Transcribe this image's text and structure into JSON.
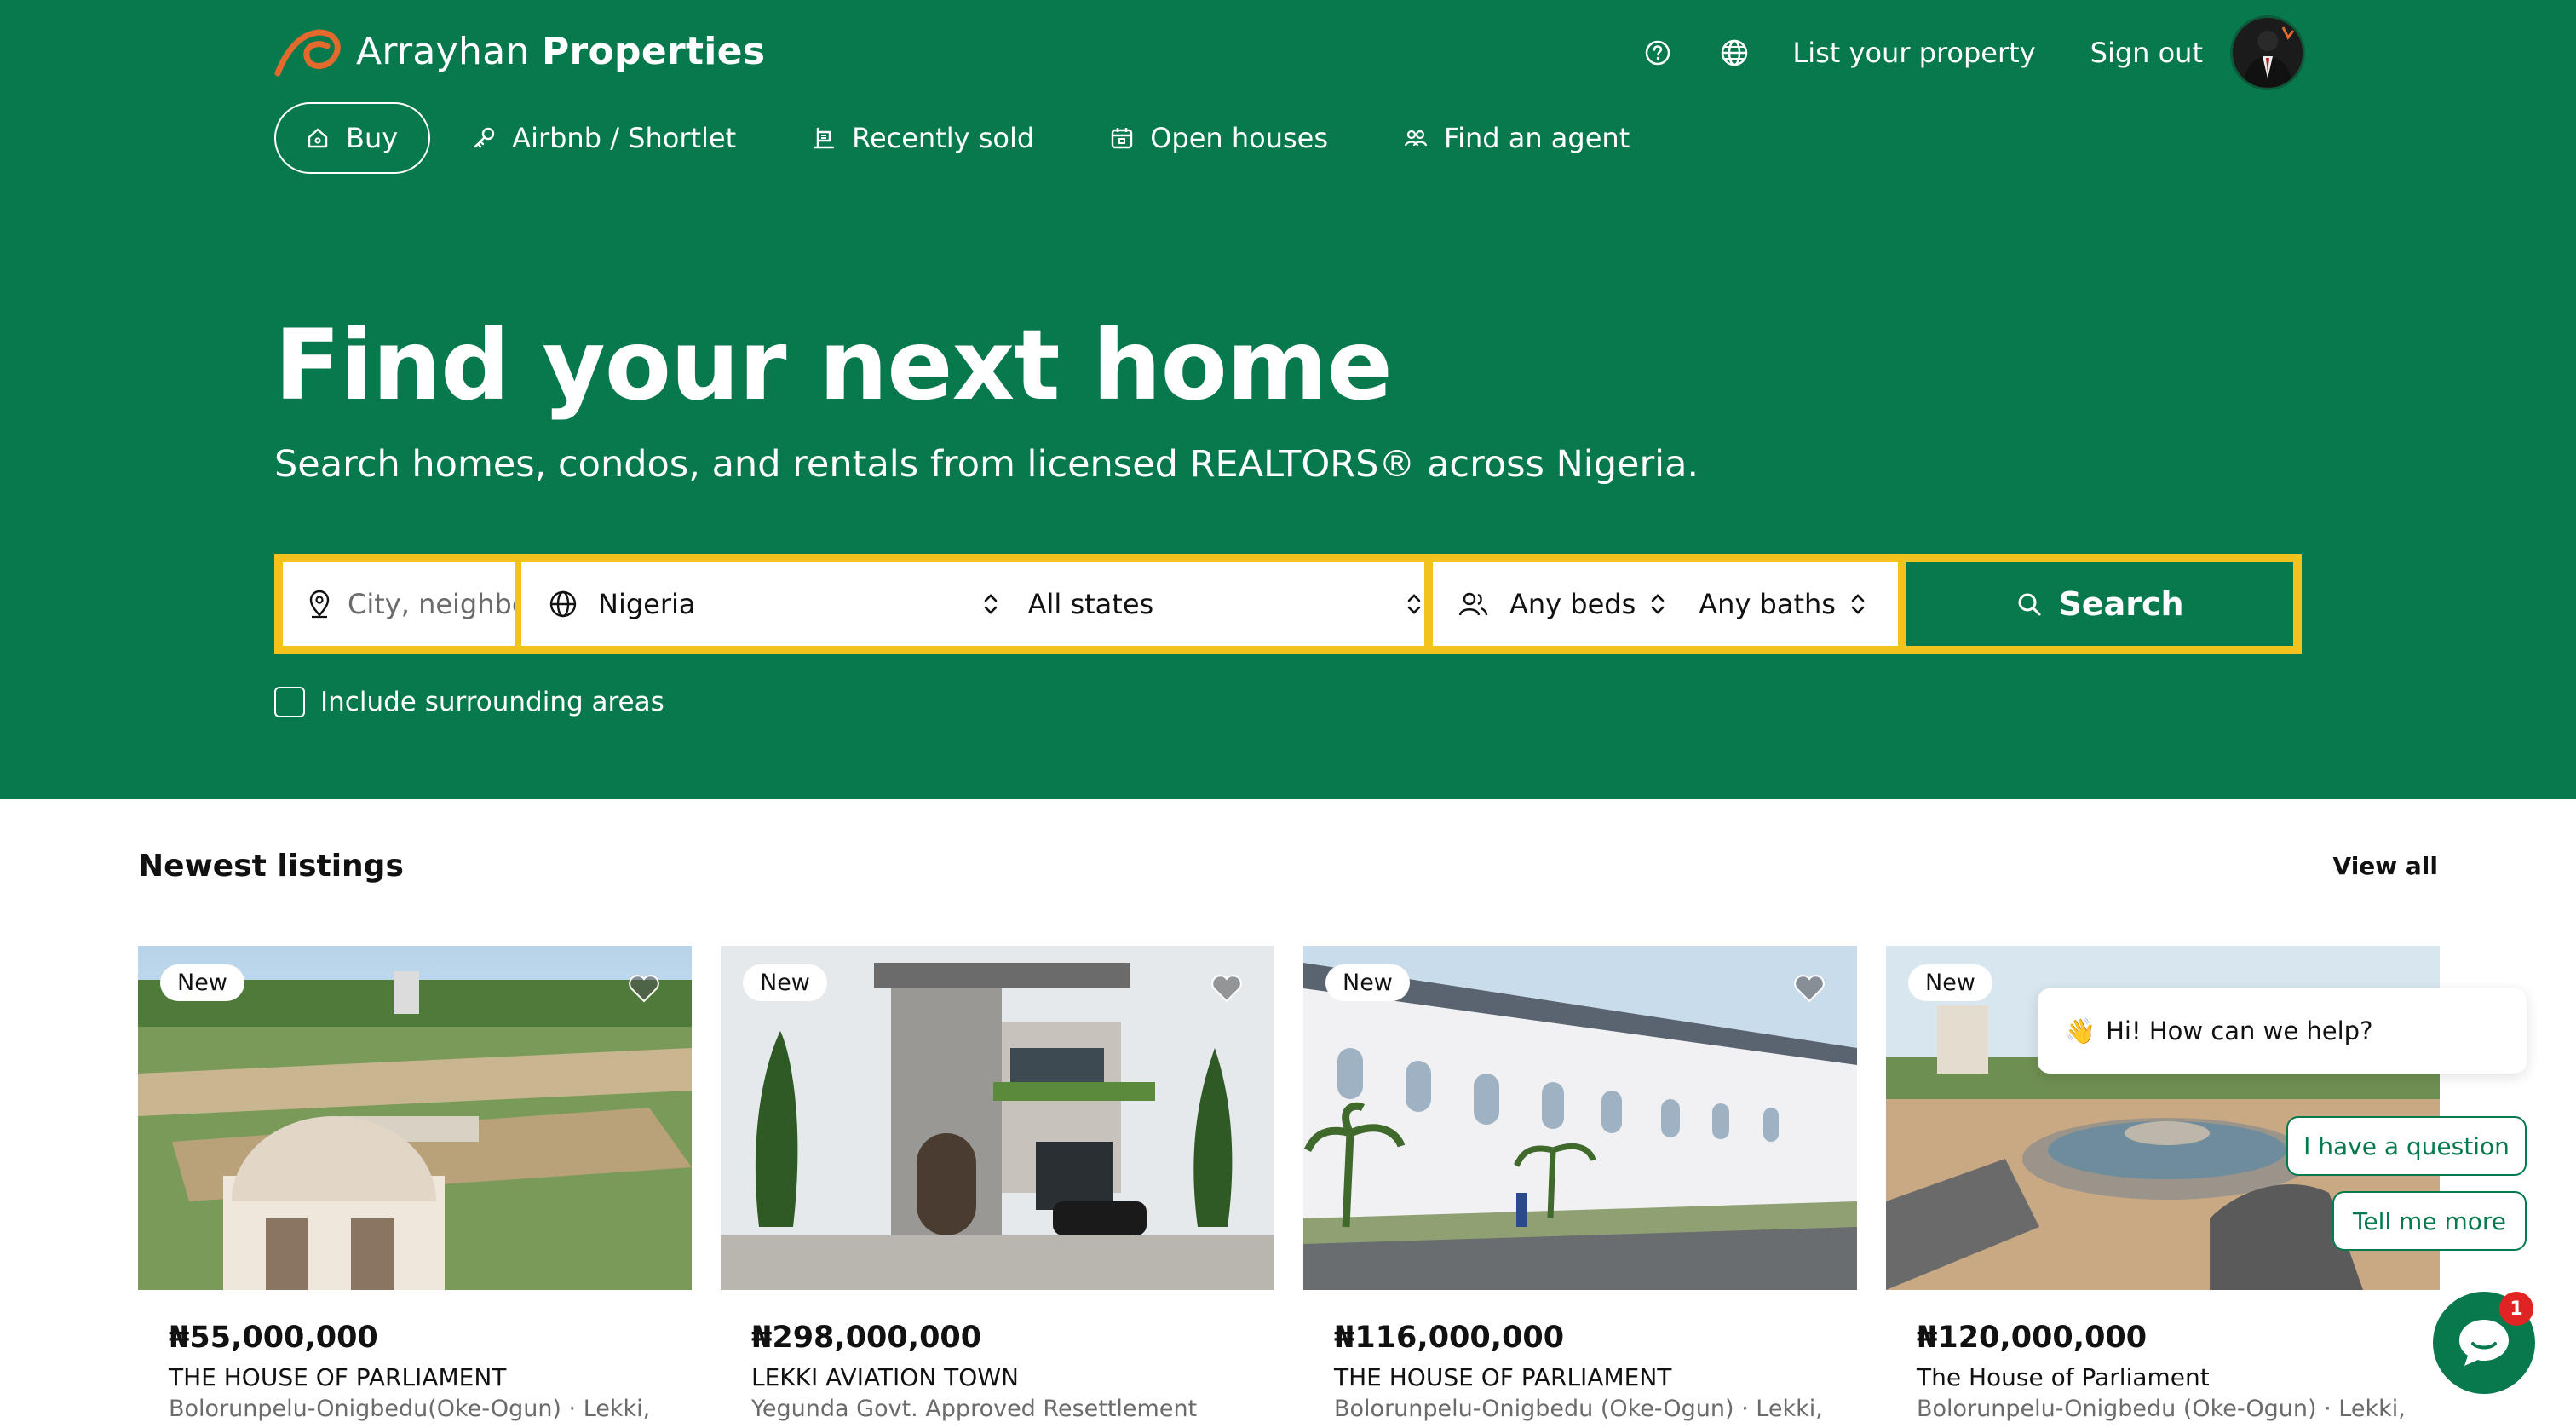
{
  "brand": {
    "name_light": "Arrayhan",
    "name_bold": "Properties",
    "accent": "#07794d",
    "logo_color": "#e36a2c"
  },
  "header": {
    "help_icon": "question-circle-icon",
    "language_icon": "globe-icon",
    "list_property": "List your property",
    "sign_out": "Sign out"
  },
  "nav": {
    "items": [
      {
        "label": "Buy",
        "icon": "home-icon",
        "active": true
      },
      {
        "label": "Airbnb / Shortlet",
        "icon": "key-icon",
        "active": false
      },
      {
        "label": "Recently sold",
        "icon": "sold-sign-icon",
        "active": false
      },
      {
        "label": "Open houses",
        "icon": "calendar-icon",
        "active": false
      },
      {
        "label": "Find an agent",
        "icon": "people-icon",
        "active": false
      }
    ]
  },
  "hero": {
    "title": "Find your next home",
    "subtitle": "Search homes, condos, and rentals from licensed REALTORS® across Nigeria."
  },
  "search": {
    "location_placeholder": "City, neighborhood",
    "country": "Nigeria",
    "state": "All states",
    "beds": "Any beds",
    "baths": "Any baths",
    "button": "Search",
    "include_surrounding": "Include surrounding areas",
    "include_checked": false,
    "highlight_color": "#f4c21d"
  },
  "listings": {
    "title": "Newest listings",
    "view_all": "View all",
    "items": [
      {
        "badge": "New",
        "price": "₦55,000,000",
        "name": "THE HOUSE OF PARLIAMENT",
        "location": "Bolorunpelu-Onigbedu(Oke-Ogun) · Lekki,"
      },
      {
        "badge": "New",
        "price": "₦298,000,000",
        "name": "LEKKI AVIATION TOWN",
        "location": "Yegunda Govt. Approved Resettlement"
      },
      {
        "badge": "New",
        "price": "₦116,000,000",
        "name": "THE HOUSE OF PARLIAMENT",
        "location": "Bolorunpelu-Onigbedu (Oke-Ogun) · Lekki,"
      },
      {
        "badge": "New",
        "price": "₦120,000,000",
        "name": "The House of Parliament",
        "location": "Bolorunpelu-Onigbedu (Oke-Ogun) · Lekki,"
      }
    ]
  },
  "chat": {
    "greeting_emoji": "👋",
    "greeting": "Hi! How can we help?",
    "option1": "I have a question",
    "option2": "Tell me more",
    "unread": "1"
  }
}
